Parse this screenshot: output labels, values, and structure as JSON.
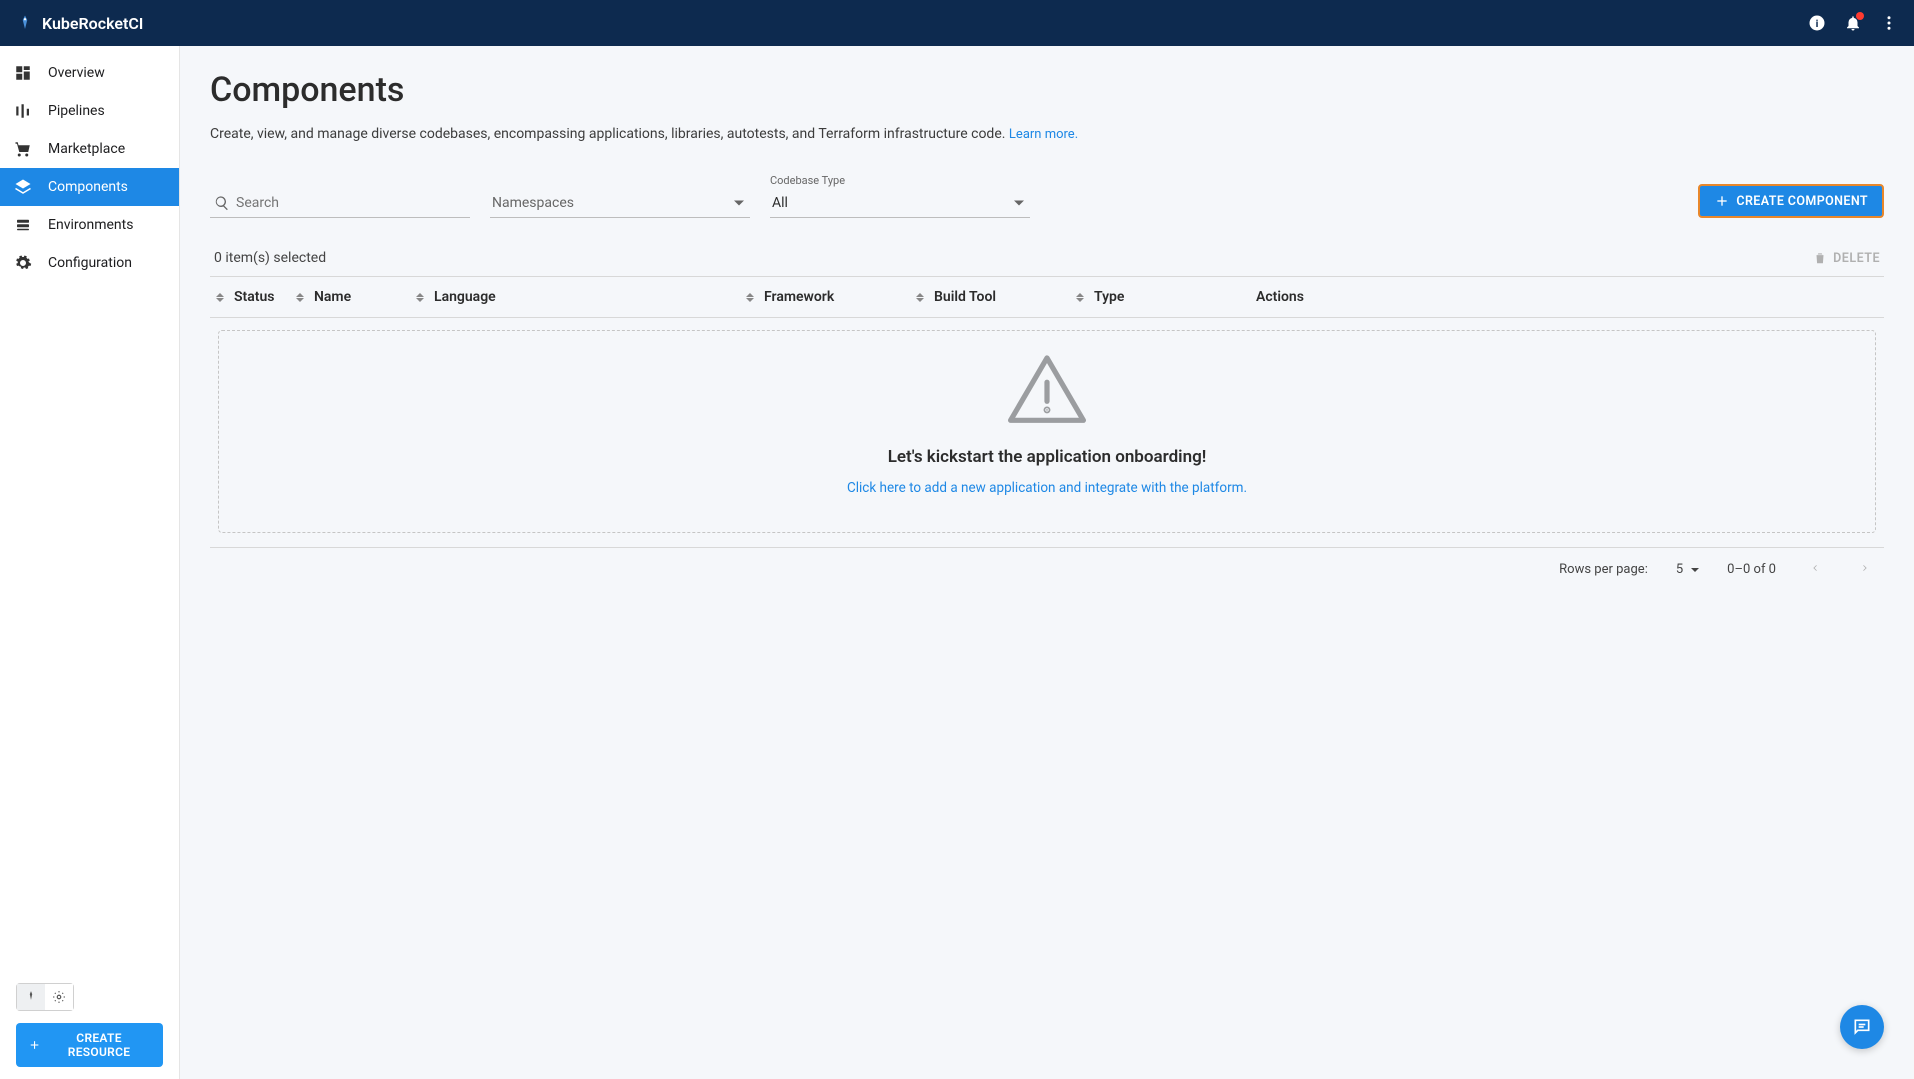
{
  "brand": "KubeRocketCI",
  "sidebar": {
    "items": [
      {
        "label": "Overview"
      },
      {
        "label": "Pipelines"
      },
      {
        "label": "Marketplace"
      },
      {
        "label": "Components"
      },
      {
        "label": "Environments"
      },
      {
        "label": "Configuration"
      }
    ],
    "create_resource": "CREATE RESOURCE"
  },
  "page": {
    "title": "Components",
    "desc": "Create, view, and manage diverse codebases, encompassing applications, libraries, autotests, and Terraform infrastructure code. ",
    "learn_more": "Learn more."
  },
  "filters": {
    "search_placeholder": "Search",
    "namespaces_placeholder": "Namespaces",
    "codebase_type_label": "Codebase Type",
    "codebase_type_value": "All",
    "create_component": "CREATE COMPONENT"
  },
  "selection": {
    "text": "0 item(s) selected",
    "delete": "DELETE"
  },
  "columns": {
    "status": "Status",
    "name": "Name",
    "language": "Language",
    "framework": "Framework",
    "build": "Build Tool",
    "type": "Type",
    "actions": "Actions"
  },
  "empty": {
    "title": "Let's kickstart the application onboarding!",
    "cta": "Click here to add a new application and integrate with the platform."
  },
  "pagination": {
    "rpp_label": "Rows per page:",
    "rpp_value": "5",
    "range": "0–0 of 0"
  }
}
